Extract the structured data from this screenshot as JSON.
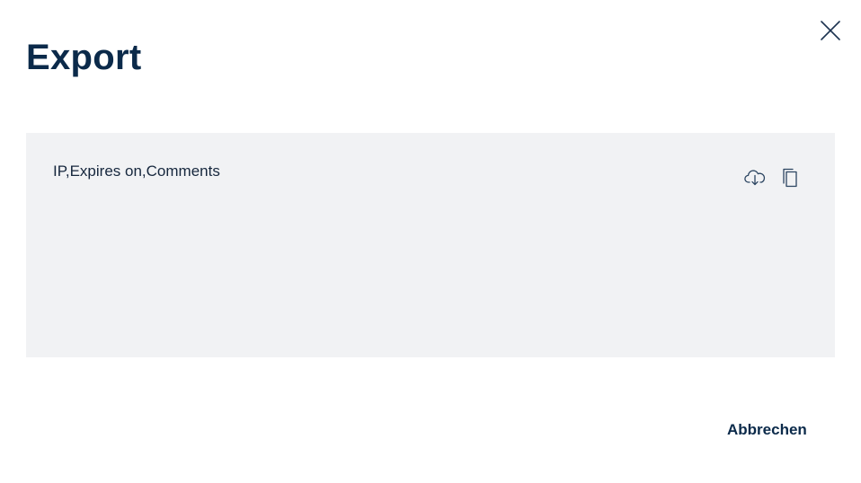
{
  "dialog": {
    "title": "Export",
    "close_icon": "close-icon",
    "content": {
      "text": "IP,Expires on,Comments",
      "download_icon": "cloud-download-icon",
      "copy_icon": "copy-icon"
    },
    "footer": {
      "cancel_label": "Abbrechen"
    }
  },
  "colors": {
    "title": "#0b2a4a",
    "box_background": "#f1f2f4",
    "text": "#16273d",
    "icon": "#2b4460"
  }
}
